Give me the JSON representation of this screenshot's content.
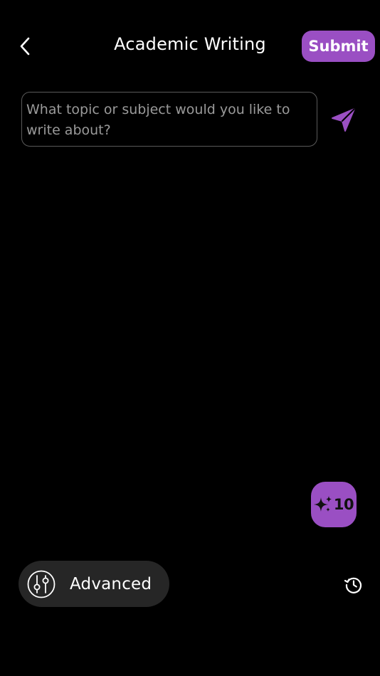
{
  "header": {
    "title": "Academic Writing",
    "submit_label": "Submit",
    "back_icon": "chevron-left-icon"
  },
  "composer": {
    "placeholder": "What topic or subject would you like to write about?",
    "value": "",
    "send_icon": "send-icon"
  },
  "credits": {
    "icon": "sparkles-icon",
    "count": "10"
  },
  "footer": {
    "advanced_label": "Advanced",
    "advanced_icon": "sliders-icon",
    "history_icon": "history-icon"
  },
  "colors": {
    "background": "#000000",
    "accent": "#9a4fc3",
    "input_border": "#5a5a5a",
    "pill_background": "#262626",
    "placeholder": "#9a9a9a"
  }
}
